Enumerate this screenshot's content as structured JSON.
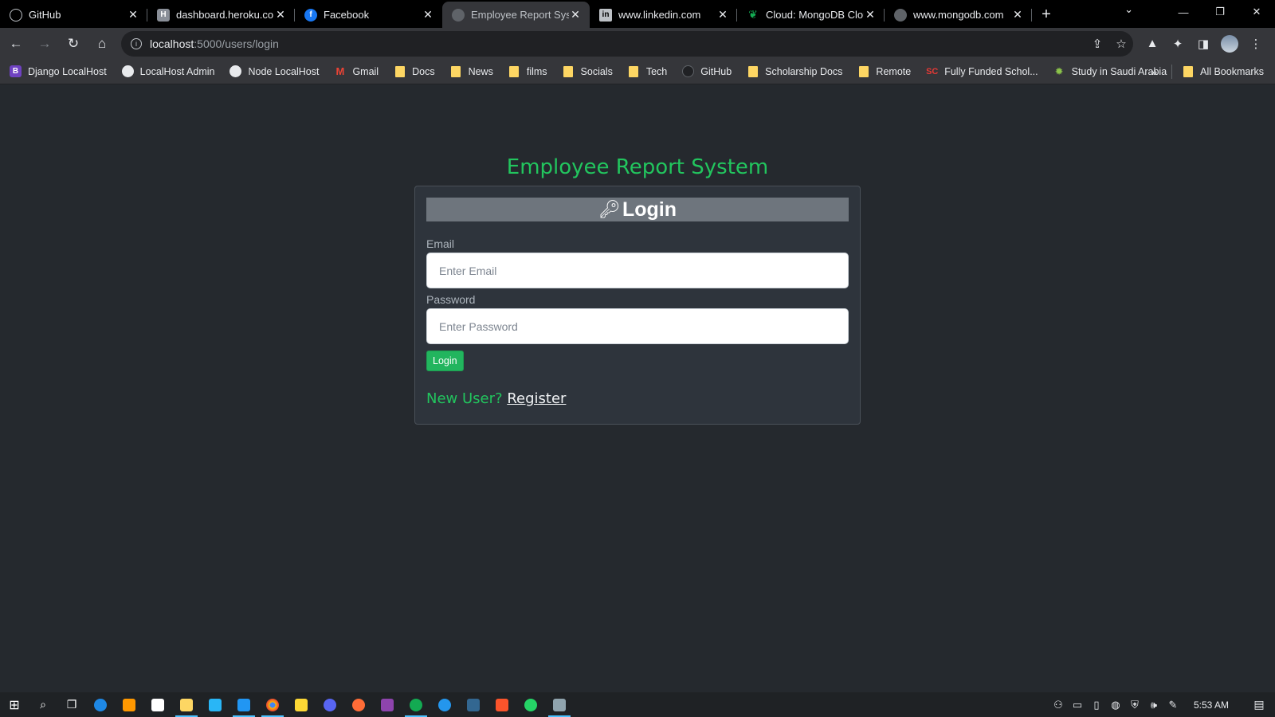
{
  "browser": {
    "tabs": [
      {
        "title": "GitHub",
        "icon": "github-icon",
        "active": false
      },
      {
        "title": "dashboard.heroku.com",
        "icon": "heroku-icon",
        "active": false
      },
      {
        "title": "Facebook",
        "icon": "facebook-icon",
        "active": false
      },
      {
        "title": "Employee Report Syste",
        "icon": "globe-icon",
        "active": true
      },
      {
        "title": "www.linkedin.com",
        "icon": "linkedin-icon",
        "active": false
      },
      {
        "title": "Cloud: MongoDB Clou",
        "icon": "mongodb-icon",
        "active": false
      },
      {
        "title": "www.mongodb.com",
        "icon": "globe-icon",
        "active": false
      }
    ],
    "address": {
      "host": "localhost",
      "path": ":5000/users/login"
    },
    "bookmarks": [
      {
        "label": "Django LocalHost",
        "icon": "bootstrap-icon"
      },
      {
        "label": "LocalHost Admin",
        "icon": "globe-icon"
      },
      {
        "label": "Node LocalHost",
        "icon": "globe-icon"
      },
      {
        "label": "Gmail",
        "icon": "gmail-icon"
      },
      {
        "label": "Docs",
        "icon": "folder-icon"
      },
      {
        "label": "News",
        "icon": "folder-icon"
      },
      {
        "label": "films",
        "icon": "folder-icon"
      },
      {
        "label": "Socials",
        "icon": "folder-icon"
      },
      {
        "label": "Tech",
        "icon": "folder-icon"
      },
      {
        "label": "GitHub",
        "icon": "github-icon"
      },
      {
        "label": "Scholarship Docs",
        "icon": "folder-icon"
      },
      {
        "label": "Remote",
        "icon": "folder-icon"
      },
      {
        "label": "Fully Funded Schol...",
        "icon": "sc-icon"
      },
      {
        "label": "Study in Saudi Arabia",
        "icon": "badge-icon"
      }
    ],
    "all_bookmarks": "All Bookmarks"
  },
  "page": {
    "app_title": "Employee Report System",
    "card_title": "Login",
    "email": {
      "label": "Email",
      "placeholder": "Enter Email",
      "value": ""
    },
    "password": {
      "label": "Password",
      "placeholder": "Enter Password",
      "value": ""
    },
    "login_button": "Login",
    "new_user_text": "New User?",
    "register_link": "Register"
  },
  "taskbar": {
    "clock": "5:53 AM"
  },
  "colors": {
    "accent_green": "#22c55e",
    "page_bg": "#25292e",
    "card_bg": "#2e343c",
    "header_gray": "#6e757d"
  }
}
